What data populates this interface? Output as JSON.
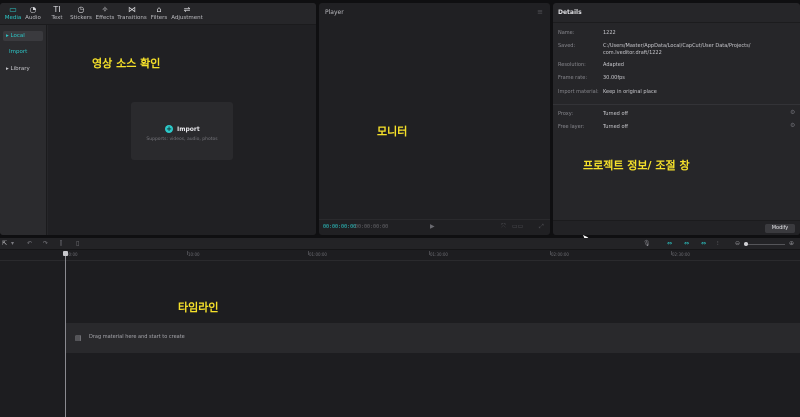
{
  "media_panel": {
    "tabs": [
      {
        "label": "Media",
        "icon": "media-icon",
        "glyph": "▭"
      },
      {
        "label": "Audio",
        "icon": "audio-icon",
        "glyph": "◔"
      },
      {
        "label": "Text",
        "icon": "text-icon",
        "glyph": "TI"
      },
      {
        "label": "Stickers",
        "icon": "stickers-icon",
        "glyph": "◷"
      },
      {
        "label": "Effects",
        "icon": "effects-icon",
        "glyph": "✧"
      },
      {
        "label": "Transitions",
        "icon": "transitions-icon",
        "glyph": "⋈"
      },
      {
        "label": "Filters",
        "icon": "filters-icon",
        "glyph": "⌂"
      },
      {
        "label": "Adjustment",
        "icon": "adjustment-icon",
        "glyph": "⇌"
      }
    ],
    "sidebar": {
      "local": "▸ Local",
      "import": "Import",
      "library": "▸ Library"
    },
    "import_box": {
      "plus": "+",
      "label": "Import",
      "hint": "Supports: videos, audio, photos"
    }
  },
  "annotations": {
    "media": "영상 소스 확인",
    "monitor": "모니터",
    "details": "프로젝트 정보/ 조절 창",
    "timeline": "타임라인"
  },
  "player": {
    "title": "Player",
    "time_current": "00:00:00:00",
    "time_total": "00:00:00:00",
    "play_glyph": "▶"
  },
  "details": {
    "title": "Details",
    "rows": [
      {
        "label": "Name:",
        "value": "1222"
      },
      {
        "label": "Saved:",
        "value": "C:/Users/Master/AppData/Local/CapCut/User Data/Projects/ com.lveditor.draft/1222"
      },
      {
        "label": "Resolution:",
        "value": "Adapted"
      },
      {
        "label": "Frame rate:",
        "value": "30.00fps"
      },
      {
        "label": "Import material:",
        "value": "Keep in original place"
      },
      {
        "label": "Proxy:",
        "value": "Turned off"
      },
      {
        "label": "Free layer:",
        "value": "Turned off"
      }
    ],
    "modify_label": "Modify"
  },
  "timeline": {
    "ruler_ticks": [
      "00:00",
      "10:00",
      "01:00:00",
      "01:30:00",
      "02:00:00",
      "02:30:00"
    ],
    "track_hint": "Drag material here and start to create"
  }
}
